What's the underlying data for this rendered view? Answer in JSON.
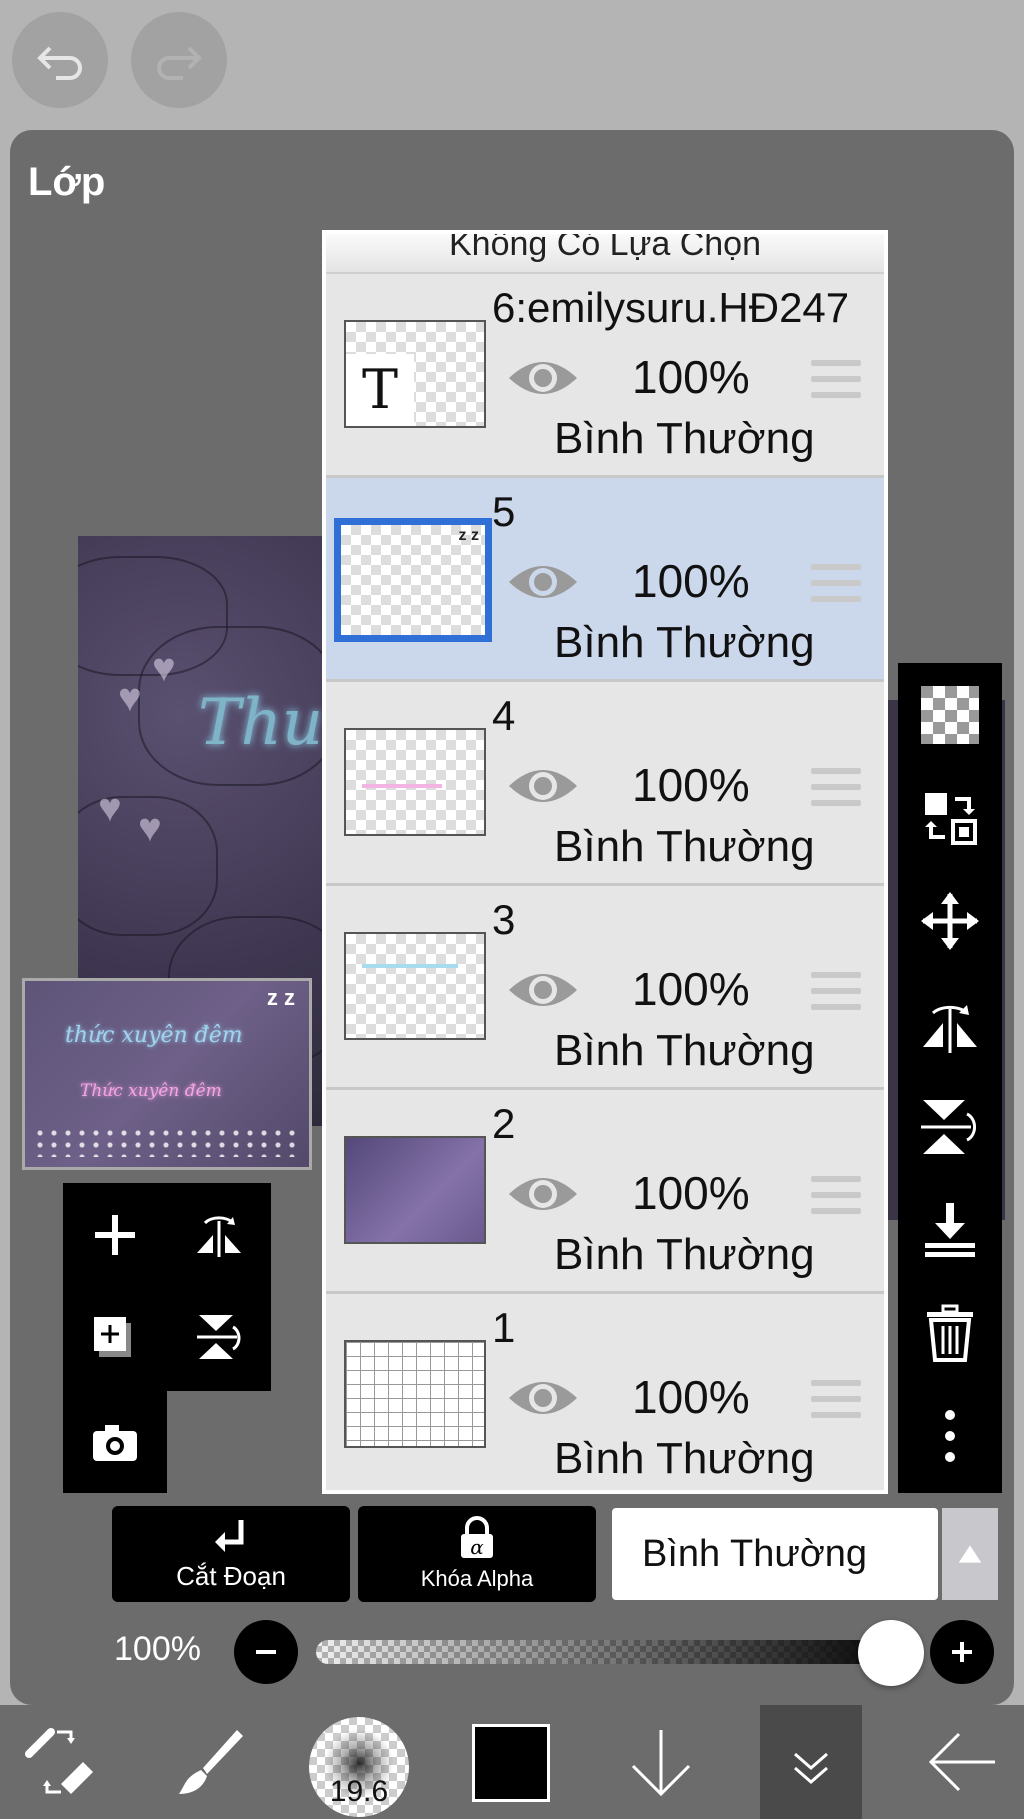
{
  "title": "Lớp",
  "top_buttons": {
    "undo": "undo-icon",
    "redo": "redo-icon"
  },
  "layers_header": "Không Có Lựa Chọn",
  "layers": [
    {
      "name": "6:emilysuru.HĐ247",
      "opacity": "100%",
      "blend": "Bình Thường",
      "visible": true,
      "selected": false,
      "thumb": "text"
    },
    {
      "name": "5",
      "opacity": "100%",
      "blend": "Bình Thường",
      "visible": true,
      "selected": true,
      "thumb": "sparkles"
    },
    {
      "name": "4",
      "opacity": "100%",
      "blend": "Bình Thường",
      "visible": true,
      "selected": false,
      "thumb": "pink-text"
    },
    {
      "name": "3",
      "opacity": "100%",
      "blend": "Bình Thường",
      "visible": true,
      "selected": false,
      "thumb": "blue-text"
    },
    {
      "name": "2",
      "opacity": "100%",
      "blend": "Bình Thường",
      "visible": true,
      "selected": false,
      "thumb": "photo"
    },
    {
      "name": "1",
      "opacity": "100%",
      "blend": "Bình Thường",
      "visible": true,
      "selected": false,
      "thumb": "grid"
    }
  ],
  "actions": {
    "clip_label": "Cắt Đoạn",
    "alpha_lock_label": "Khóa Alpha"
  },
  "blend_mode": "Bình Thường",
  "opacity": {
    "label": "100%",
    "value": 1.0
  },
  "brush_size": "19.6",
  "current_color": "#000000",
  "colors": {
    "panel": "#6c6c6c",
    "selected_layer": "#cbd8ec",
    "selection_border": "#2f6fd6",
    "background": "#b4b4b4"
  },
  "canvas_text": {
    "neon": "Thu"
  },
  "thumbnail_text": {
    "line1": "thức xuyên đêm",
    "line2": "Thức xuyên đêm",
    "zz": "z z"
  }
}
